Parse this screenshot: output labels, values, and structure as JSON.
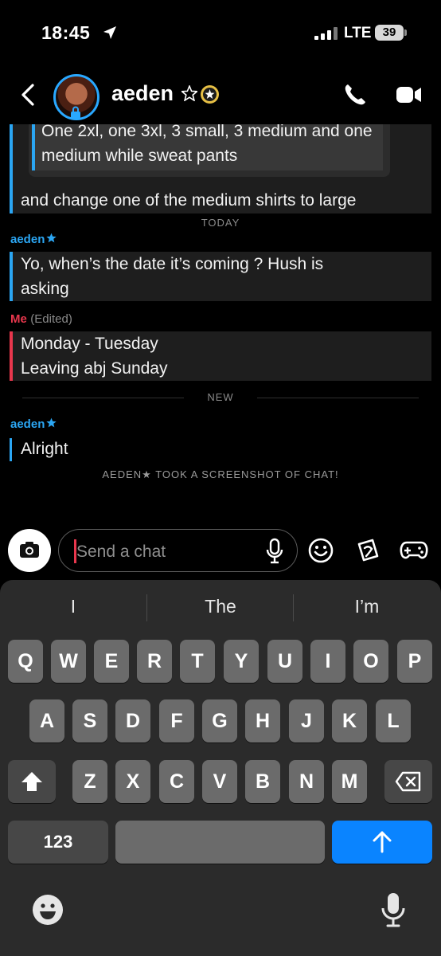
{
  "status_bar": {
    "time": "18:45",
    "network": "LTE",
    "battery": "39"
  },
  "header": {
    "contact_name": "aeden"
  },
  "messages": {
    "quoted_text": "One 2xl, one 3xl, 3 small, 3 medium and one medium while sweat pants",
    "msg1_text": "and change one of the medium shirts to large",
    "divider_today": "TODAY",
    "sender_aeden": "aeden",
    "msg2_text": "Yo, when’s the date it’s coming ? Hush is asking",
    "sender_me": "Me",
    "edited_label": "(Edited)",
    "msg3_text": "Monday - Tuesday\nLeaving abj Sunday",
    "divider_new": "NEW",
    "sender_aeden_2": "aeden",
    "msg4_text": "Alright",
    "system_note": "AEDEN★ TOOK A SCREENSHOT OF CHAT!"
  },
  "input": {
    "placeholder": "Send a chat"
  },
  "keyboard": {
    "suggestions": [
      "I",
      "The",
      "I’m"
    ],
    "row1": [
      "Q",
      "W",
      "E",
      "R",
      "T",
      "Y",
      "U",
      "I",
      "O",
      "P"
    ],
    "row2": [
      "A",
      "S",
      "D",
      "F",
      "G",
      "H",
      "J",
      "K",
      "L"
    ],
    "row3": [
      "Z",
      "X",
      "C",
      "V",
      "B",
      "N",
      "M"
    ],
    "numbers_key": "123"
  },
  "colors": {
    "accent_blue": "#2ba6f3",
    "me_red": "#e8374d",
    "send_blue": "#0a84ff"
  },
  "icons": [
    "location-arrow-icon",
    "signal-icon",
    "battery-icon",
    "back-chevron-icon",
    "lock-icon",
    "star-icon",
    "gold-badge-icon",
    "phone-icon",
    "video-icon",
    "camera-icon",
    "mic-icon",
    "smile-icon",
    "sticker-icon",
    "game-controller-icon",
    "shift-icon",
    "delete-icon",
    "return-arrow-icon",
    "emoji-icon",
    "dictation-mic-icon"
  ]
}
